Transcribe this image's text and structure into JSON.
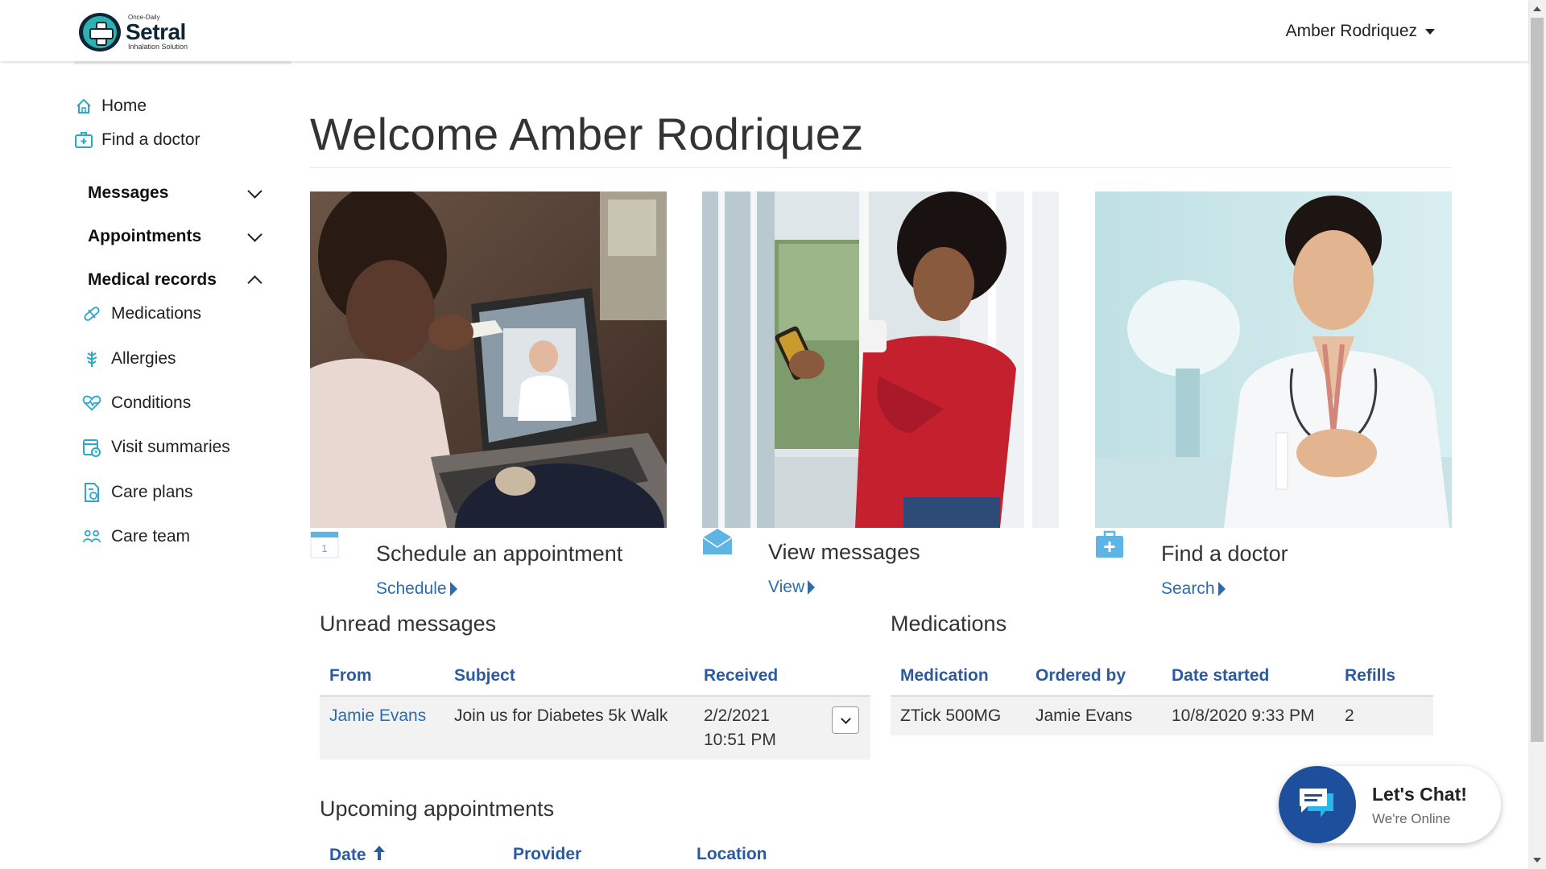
{
  "header": {
    "logo_small": "Once-Daily",
    "logo_name": "Setral",
    "logo_tagline": "Inhalation Solution",
    "user_name": "Amber Rodriquez"
  },
  "sidebar": {
    "links": [
      {
        "label": "Home",
        "icon": "home-icon"
      },
      {
        "label": "Find a doctor",
        "icon": "doctor-bag-icon"
      }
    ],
    "sections": [
      {
        "label": "Messages",
        "expanded": false
      },
      {
        "label": "Appointments",
        "expanded": false
      },
      {
        "label": "Medical records",
        "expanded": true
      }
    ],
    "medical_records_items": [
      {
        "label": "Medications",
        "icon": "pill-icon"
      },
      {
        "label": "Allergies",
        "icon": "allergy-icon"
      },
      {
        "label": "Conditions",
        "icon": "heart-pulse-icon"
      },
      {
        "label": "Visit summaries",
        "icon": "calendar-clock-icon"
      },
      {
        "label": "Care plans",
        "icon": "care-plan-icon"
      },
      {
        "label": "Care team",
        "icon": "team-icon"
      }
    ]
  },
  "main": {
    "title": "Welcome Amber Rodriquez",
    "cards": [
      {
        "title": "Schedule an appointment",
        "link": "Schedule",
        "icon": "calendar-icon"
      },
      {
        "title": "View messages",
        "link": "View",
        "icon": "envelope-icon"
      },
      {
        "title": "Find a doctor",
        "link": "Search",
        "icon": "medical-kit-icon"
      }
    ],
    "unread_messages": {
      "title": "Unread messages",
      "columns": [
        "From",
        "Subject",
        "Received"
      ],
      "rows": [
        {
          "from": "Jamie Evans",
          "subject": "Join us for Diabetes 5k Walk",
          "received_date": "2/2/2021",
          "received_time": "10:51 PM"
        }
      ]
    },
    "medications": {
      "title": "Medications",
      "columns": [
        "Medication",
        "Ordered by",
        "Date started",
        "Refills"
      ],
      "rows": [
        {
          "medication": "ZTick 500MG",
          "ordered_by": "Jamie Evans",
          "date_started": "10/8/2020 9:33 PM",
          "refills": "2"
        }
      ]
    },
    "upcoming_appointments": {
      "title": "Upcoming appointments",
      "columns": [
        "Date",
        "Provider",
        "Location"
      ]
    }
  },
  "chat": {
    "title": "Let's Chat!",
    "status": "We're Online"
  },
  "colors": {
    "link": "#2b6cb0",
    "header_text": "#2b5aa0",
    "chat_blue": "#1d4f9c",
    "icon_teal": "#2aa7c9"
  }
}
